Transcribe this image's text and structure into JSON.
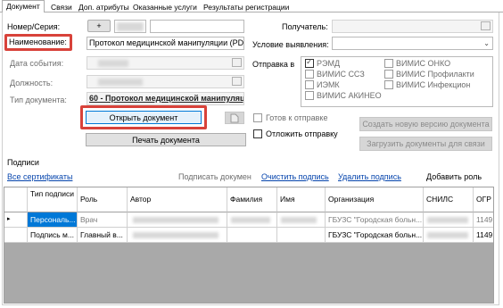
{
  "tabs": [
    "Документ",
    "Связи",
    "Доп. атрибуты",
    "Оказанные услуги",
    "Результаты регистрации"
  ],
  "labels": {
    "nomer": "Номер/Серия:",
    "naimenovanie": "Наименование:",
    "data_sobytiya": "Дата события:",
    "dolzhnost": "Должность:",
    "tip_dokumenta": "Тип документа:",
    "poluchatel": "Получатель:",
    "uslovie": "Условие выявления:",
    "otpravka": "Отправка в"
  },
  "fields": {
    "plus_button": "+",
    "naimenovanie_value": "Протокол медицинской манипуляции (PDF-А",
    "tip_dokumenta_value": "60 - Протокол медицинской манипуляц"
  },
  "send_targets": [
    "РЭМД",
    "ВИМИС ССЗ",
    "ИЭМК",
    "ВИМИС АКИНЕО",
    "ВИМИС ОНКО",
    "ВИМИС Профилакти",
    "ВИМИС Инфекцион"
  ],
  "buttons": {
    "open_document": "Открыть документ",
    "print_document": "Печать документа",
    "create_version": "Создать новую версию документа",
    "load_documents": "Загрузить документы для связи"
  },
  "checkboxes": {
    "ready": "Готов к отправке",
    "postpone": "Отложить отправку"
  },
  "signatures": {
    "section_title": "Подписи",
    "all_certs": "Все сертификаты",
    "sign_document": "Подписать докумен",
    "clear_signature": "Очистить подпись",
    "delete_signature": "Удалить подпись",
    "add_role": "Добавить роль",
    "columns": [
      "Тип подписи",
      "Роль",
      "Автор",
      "Фамилия",
      "Имя",
      "Организация",
      "СНИЛС",
      "ОГР"
    ],
    "rows": [
      {
        "type": "Персональ...",
        "role": "Врач",
        "org": "ГБУЗС \"Городская больн...",
        "ogrn": "1149..."
      },
      {
        "type": "Подпись м...",
        "role": "Главный в...",
        "org": "ГБУЗС \"Городская больн...",
        "ogrn": "1149..."
      }
    ],
    "row_marker": "▸"
  }
}
